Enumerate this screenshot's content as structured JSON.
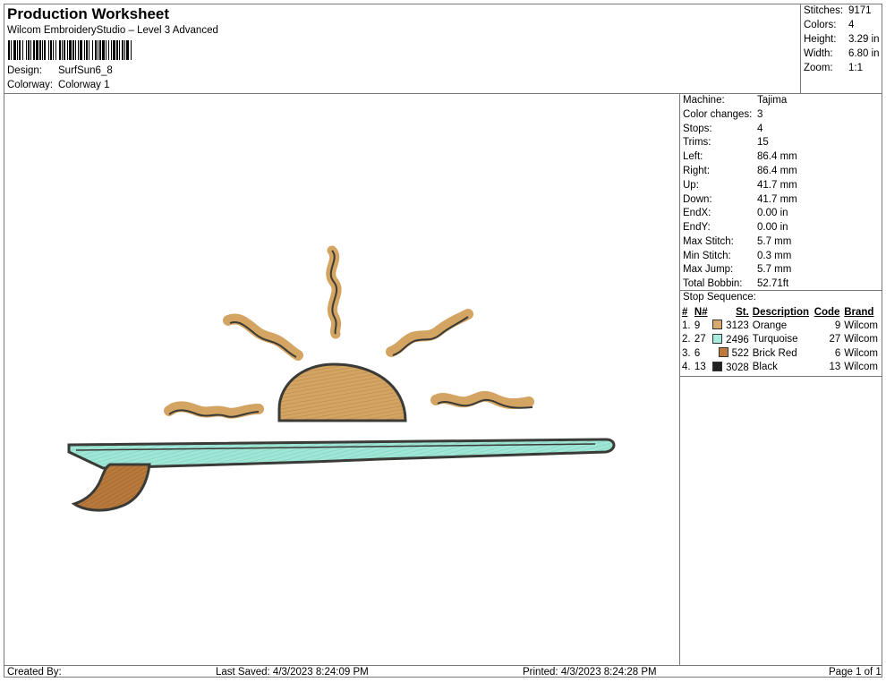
{
  "header": {
    "title": "Production Worksheet",
    "software": "Wilcom EmbroideryStudio – Level 3 Advanced",
    "design_label": "Design:",
    "design_value": "SurfSun6_8",
    "colorway_label": "Colorway:",
    "colorway_value": "Colorway 1"
  },
  "stats": [
    {
      "label": "Stitches:",
      "value": "9171"
    },
    {
      "label": "Colors:",
      "value": "4"
    },
    {
      "label": "Height:",
      "value": "3.29 in"
    },
    {
      "label": "Width:",
      "value": "6.80 in"
    },
    {
      "label": "Zoom:",
      "value": "1:1"
    }
  ],
  "machine_info": [
    {
      "label": "Machine:",
      "value": "Tajima"
    },
    {
      "label": "Color changes:",
      "value": "3"
    },
    {
      "label": "Stops:",
      "value": "4"
    },
    {
      "label": "Trims:",
      "value": "15"
    },
    {
      "label": "Left:",
      "value": "86.4 mm"
    },
    {
      "label": "Right:",
      "value": "86.4 mm"
    },
    {
      "label": "Up:",
      "value": "41.7 mm"
    },
    {
      "label": "Down:",
      "value": "41.7 mm"
    },
    {
      "label": "EndX:",
      "value": "0.00 in"
    },
    {
      "label": "EndY:",
      "value": "0.00 in"
    },
    {
      "label": "Max Stitch:",
      "value": "5.7 mm"
    },
    {
      "label": "Min Stitch:",
      "value": "0.3 mm"
    },
    {
      "label": "Max Jump:",
      "value": "5.7 mm"
    },
    {
      "label": "Total Bobbin:",
      "value": "52.71ft"
    }
  ],
  "stop_sequence": {
    "title": "Stop Sequence:",
    "headers": [
      "#",
      "N#",
      "St.",
      "Description",
      "Code",
      "Brand"
    ],
    "rows": [
      {
        "num": "1.",
        "needle": "9",
        "color": "#d9a86c",
        "stitch": "3123",
        "description": "Orange",
        "code": "9",
        "brand": "Wilcom"
      },
      {
        "num": "2.",
        "needle": "27",
        "color": "#a8ecdf",
        "stitch": "2496",
        "description": "Turquoise",
        "code": "27",
        "brand": "Wilcom"
      },
      {
        "num": "3.",
        "needle": "6",
        "color": "#c07a3e",
        "stitch": "522",
        "description": "Brick Red",
        "code": "6",
        "brand": "Wilcom"
      },
      {
        "num": "4.",
        "needle": "13",
        "color": "#222222",
        "stitch": "3028",
        "description": "Black",
        "code": "13",
        "brand": "Wilcom"
      }
    ]
  },
  "footer": {
    "created_by": "Created By:",
    "last_saved": "Last Saved: 4/3/2023 8:24:09 PM",
    "printed": "Printed: 4/3/2023 8:24:28 PM",
    "page": "Page 1 of 1"
  },
  "design_colors": {
    "sun": "#d4a462",
    "outline": "#3a3a36",
    "board": "#9fe6d6",
    "fin": "#b87a3c"
  }
}
